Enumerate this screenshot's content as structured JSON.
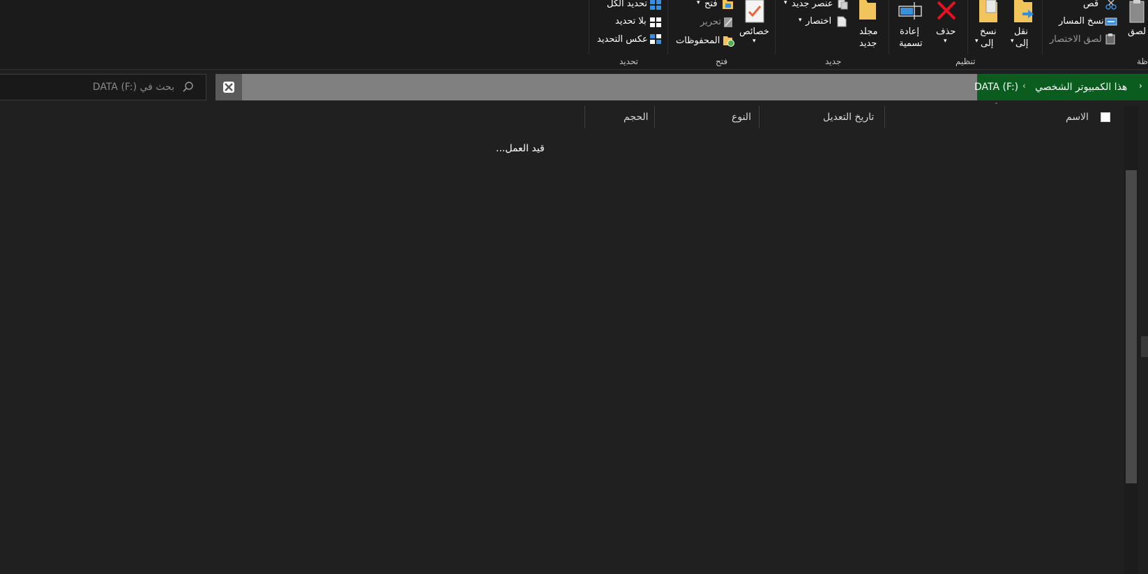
{
  "ribbon": {
    "clipboard": {
      "cut": "قص",
      "copy_path": "نسخ المسار",
      "paste_shortcut": "لصق الاختصار",
      "paste": "لصق",
      "group_label": "ظة"
    },
    "organize": {
      "move_to_line1": "نقل",
      "move_to_line2": "إلى",
      "copy_to_line1": "نسخ",
      "copy_to_line2": "إلى",
      "delete": "حذف",
      "rename_line1": "إعادة",
      "rename_line2": "تسمية",
      "group_label": "تنظيم"
    },
    "new": {
      "new_folder_line1": "مجلد",
      "new_folder_line2": "جديد",
      "new_item": "عنصر جديد",
      "easy_access": "اختصار",
      "group_label": "جديد"
    },
    "open": {
      "properties": "خصائص",
      "open": "فتح",
      "edit": "تحرير",
      "history": "المحفوظات",
      "group_label": "فتح"
    },
    "select": {
      "select_all": "تحديد الكل",
      "select_none": "بلا تحديد",
      "invert_selection": "عكس التحديد",
      "group_label": "تحديد"
    }
  },
  "address": {
    "this_pc": "هذا الكمبيوتر الشخصي",
    "drive": "DATA (F:)"
  },
  "search": {
    "placeholder": "بحث في DATA (F:)"
  },
  "columns": {
    "name": "الاسم",
    "date_modified": "تاريخ التعديل",
    "type": "النوع",
    "size": "الحجم"
  },
  "status": {
    "working": "قيد العمل..."
  },
  "colors": {
    "background": "#202020",
    "ribbon": "#1b1b1b",
    "address_bar": "#808080",
    "address_highlight": "#0a5d1e",
    "delete_red": "#e81123",
    "folder_yellow": "#f2c55c",
    "accent_blue": "#3b8fd9"
  }
}
